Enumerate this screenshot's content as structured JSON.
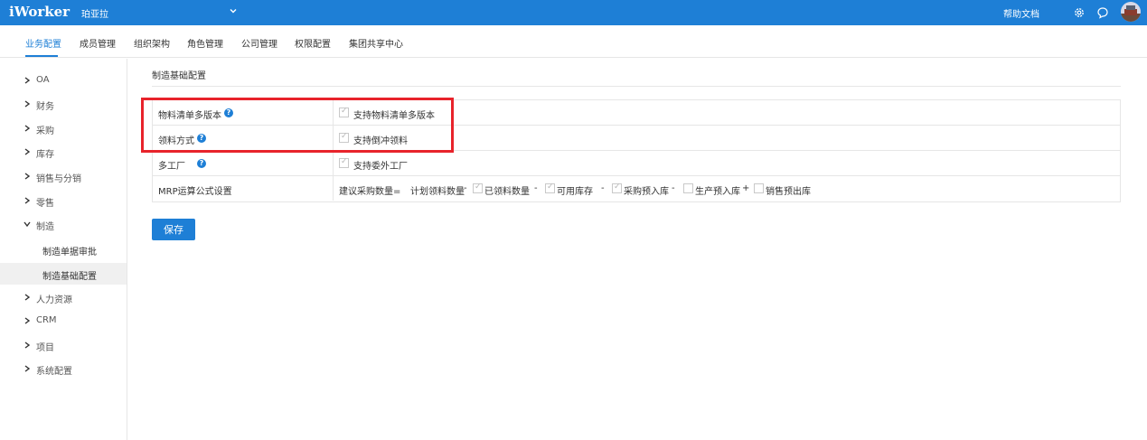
{
  "header": {
    "brand": "iWorker",
    "company": "珀亚拉",
    "help": "帮助文档",
    "colors": {
      "primary": "#1e7fd6",
      "highlight": "#e8232b"
    }
  },
  "tabs": [
    {
      "label": "业务配置",
      "active": true
    },
    {
      "label": "成员管理"
    },
    {
      "label": "组织架构"
    },
    {
      "label": "角色管理"
    },
    {
      "label": "公司管理"
    },
    {
      "label": "权限配置"
    },
    {
      "label": "集团共享中心"
    }
  ],
  "sidebar": {
    "items": [
      {
        "label": "OA"
      },
      {
        "label": "财务"
      },
      {
        "label": "采购"
      },
      {
        "label": "库存"
      },
      {
        "label": "销售与分销"
      },
      {
        "label": "零售"
      },
      {
        "label": "制造",
        "expanded": true
      },
      {
        "label": "人力资源"
      },
      {
        "label": "CRM"
      },
      {
        "label": "项目"
      },
      {
        "label": "系统配置"
      }
    ],
    "sub_items": [
      {
        "label": "制造单据审批"
      },
      {
        "label": "制造基础配置",
        "selected": true
      }
    ]
  },
  "main": {
    "section_title": "制造基础配置",
    "rows": [
      {
        "label": "物料清单多版本",
        "help": "?",
        "option": "支持物料清单多版本",
        "checked": true
      },
      {
        "label": "领料方式",
        "help": "?",
        "option": "支持倒冲领料",
        "checked": true
      },
      {
        "label": "多工厂",
        "help": "?",
        "option": "支持委外工厂",
        "checked": true
      }
    ],
    "mrp": {
      "label": "MRP运算公式设置",
      "prefix": "建议采购数量=",
      "base": "计划领料数量",
      "ops": [
        "-",
        "-",
        "-",
        "-",
        "+"
      ],
      "terms": [
        {
          "label": "已领料数量",
          "checked": true
        },
        {
          "label": "可用库存",
          "checked": true
        },
        {
          "label": "采购预入库",
          "checked": true
        },
        {
          "label": "生产预入库",
          "checked": false
        },
        {
          "label": "销售预出库",
          "checked": false
        }
      ]
    },
    "save_label": "保存"
  }
}
